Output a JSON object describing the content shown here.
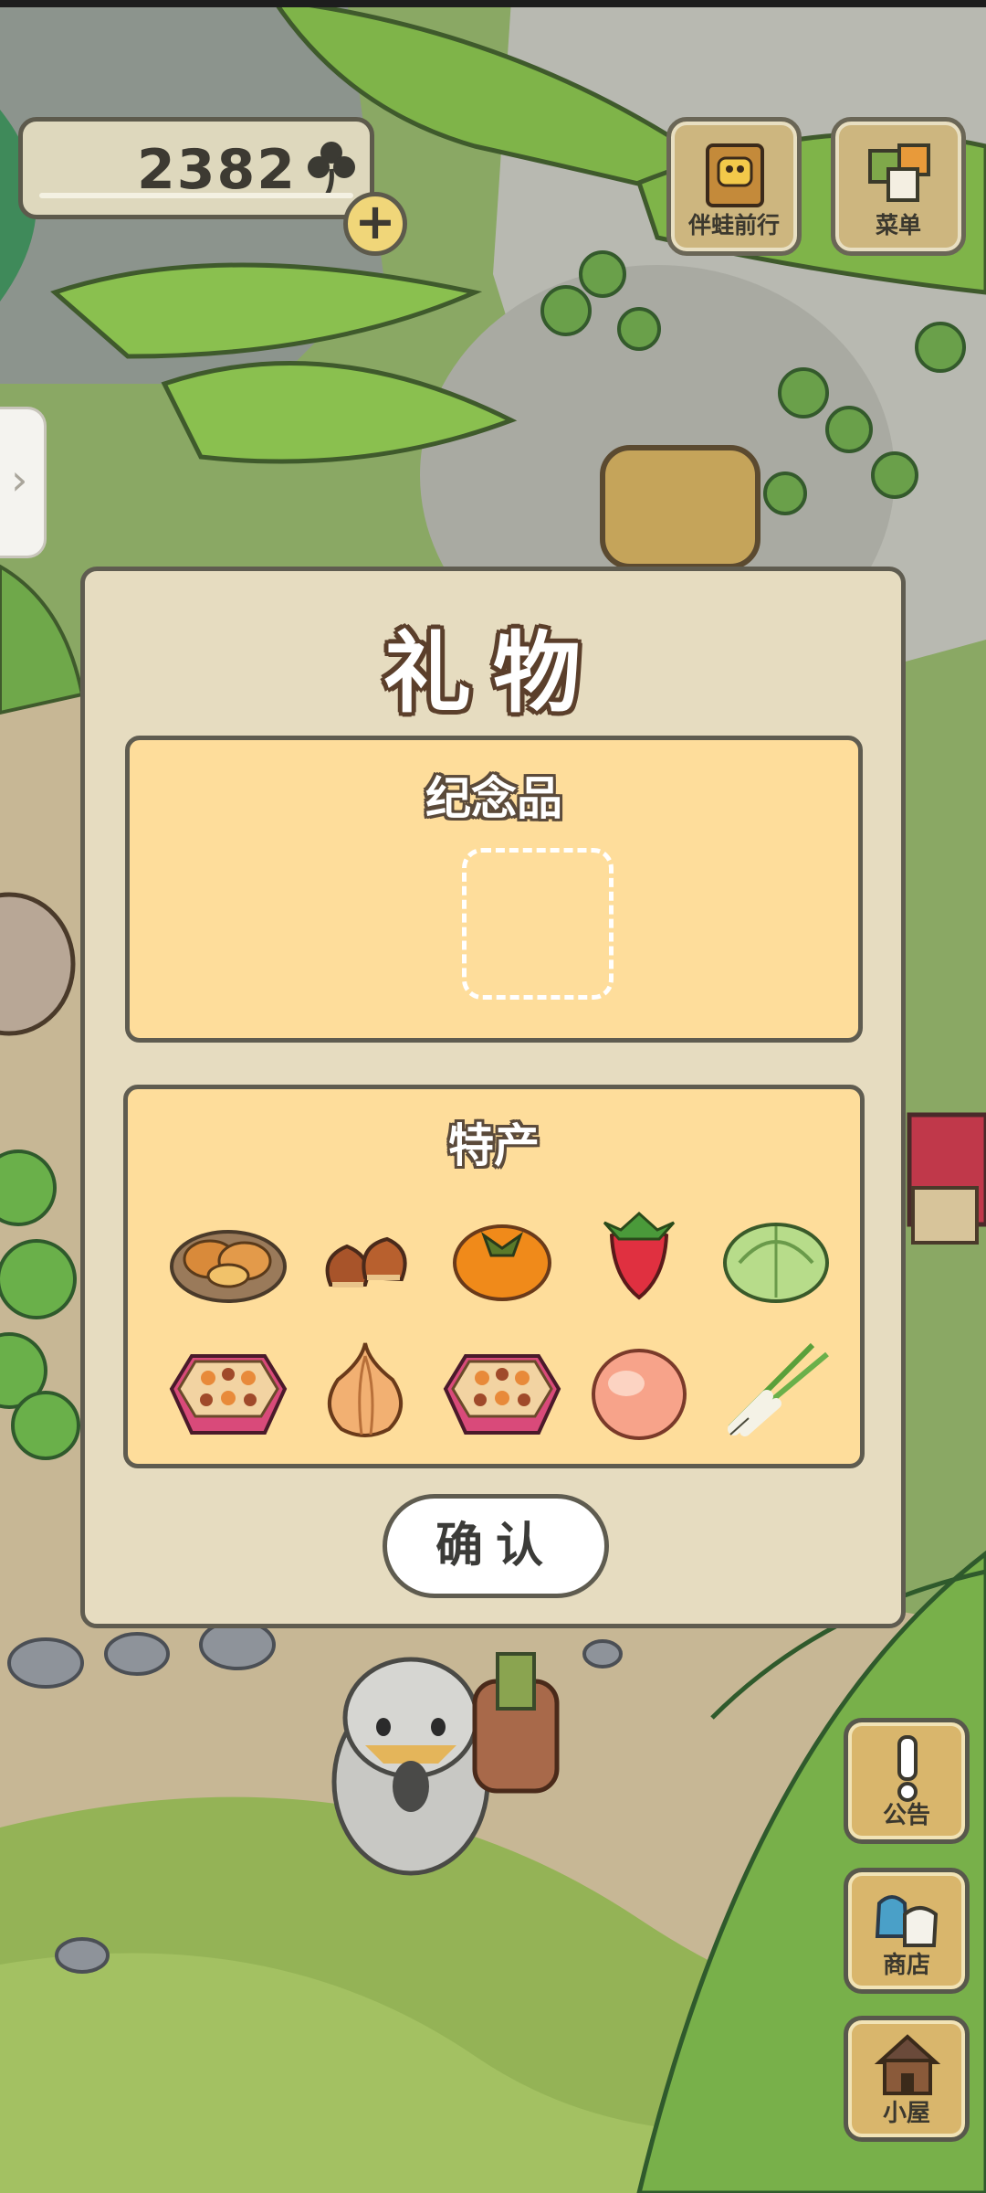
{
  "currency": {
    "amount": "2382",
    "icon": "clover-icon"
  },
  "top_buttons": {
    "travel_label": "伴蛙前行",
    "menu_label": "菜单"
  },
  "dialog": {
    "title": "礼物",
    "souvenir": {
      "title": "纪念品",
      "slot": "empty"
    },
    "specialty": {
      "title": "特产",
      "items": [
        "pastry-plate-icon",
        "chestnuts-icon",
        "persimmon-icon",
        "strawberry-icon",
        "cabbage-icon",
        "bento-box-icon",
        "onion-icon",
        "bento-box-icon",
        "peach-icon",
        "green-onion-icon"
      ]
    },
    "confirm_label": "确认"
  },
  "side_buttons": {
    "notice_label": "公告",
    "shop_label": "商店",
    "house_label": "小屋"
  },
  "colors": {
    "dialog_bg": "#e6dcc0",
    "panel_bg": "#fedd9b",
    "border": "#5f5c50",
    "foliage": "#7fb449"
  }
}
